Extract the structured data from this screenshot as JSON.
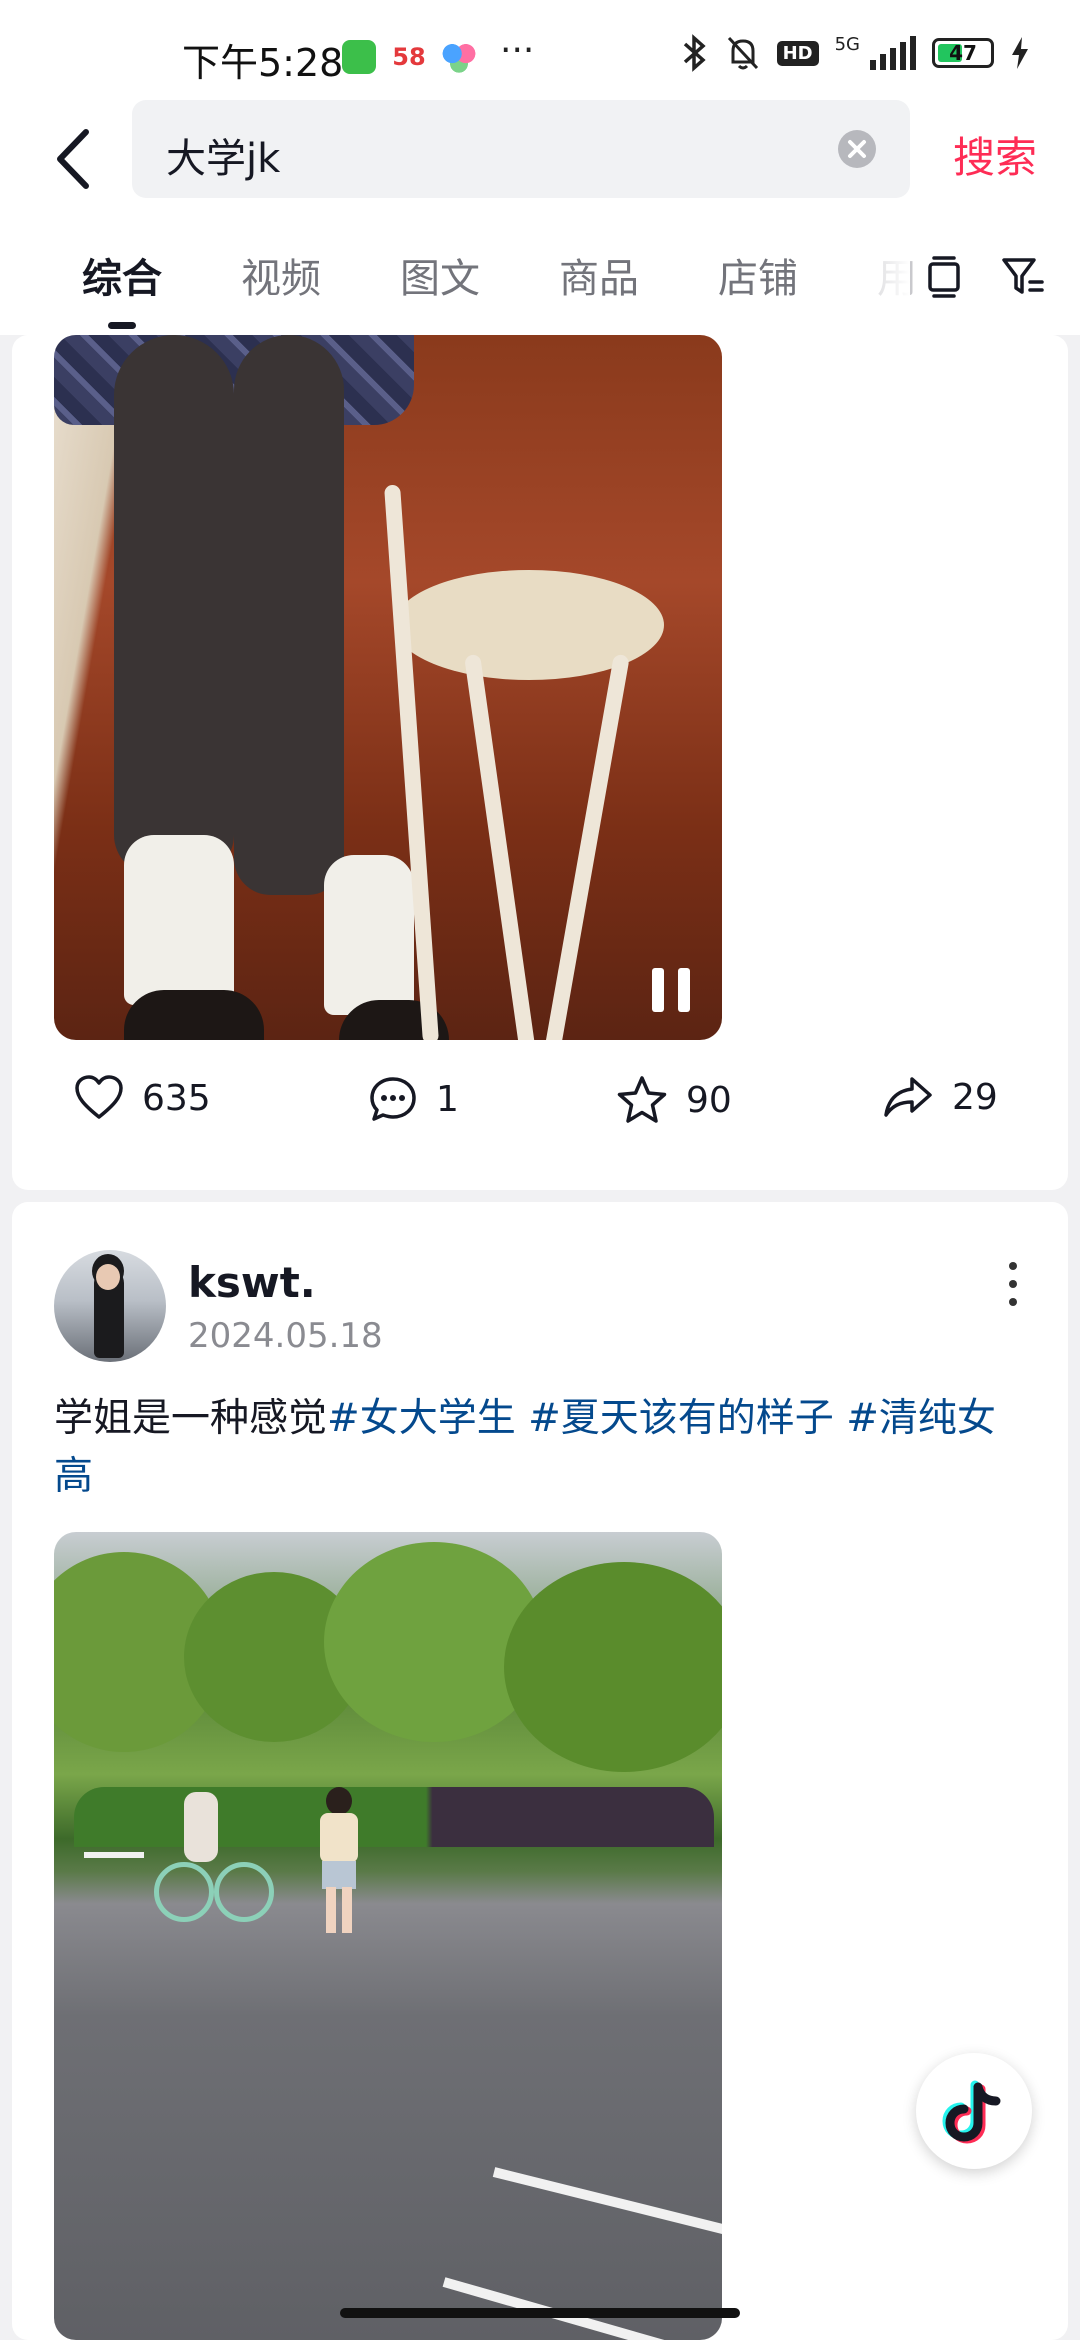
{
  "status_bar": {
    "time": "下午5:28",
    "app_58_label": "58",
    "battery_level": "47",
    "network": "5G",
    "hd": "HD",
    "more": "···"
  },
  "search": {
    "query": "大学jk",
    "submit_label": "搜索"
  },
  "tabs": [
    {
      "label": "综合",
      "active": true
    },
    {
      "label": "视频",
      "active": false
    },
    {
      "label": "图文",
      "active": false
    },
    {
      "label": "商品",
      "active": false
    },
    {
      "label": "店铺",
      "active": false
    },
    {
      "label": "用",
      "active": false
    }
  ],
  "posts": [
    {
      "media_state": "paused",
      "stats": {
        "likes": "635",
        "comments": "1",
        "favorites": "90",
        "shares": "29"
      }
    },
    {
      "author": "kswt.",
      "date": "2024.05.18",
      "caption_text": "学姐是一种感觉",
      "hashtags": [
        "#女大学生",
        "#夏天该有的样子",
        "#清纯女高"
      ]
    }
  ],
  "colors": {
    "accent": "#fe2c55",
    "hashtag": "#04498d",
    "text_primary": "#161823",
    "text_secondary": "#8a8b91"
  },
  "icons": [
    "back-icon",
    "clear-icon",
    "layout-icon",
    "filter-icon",
    "heart-icon",
    "comment-icon",
    "star-icon",
    "share-icon",
    "more-icon",
    "pause-icon",
    "douyin-icon"
  ]
}
